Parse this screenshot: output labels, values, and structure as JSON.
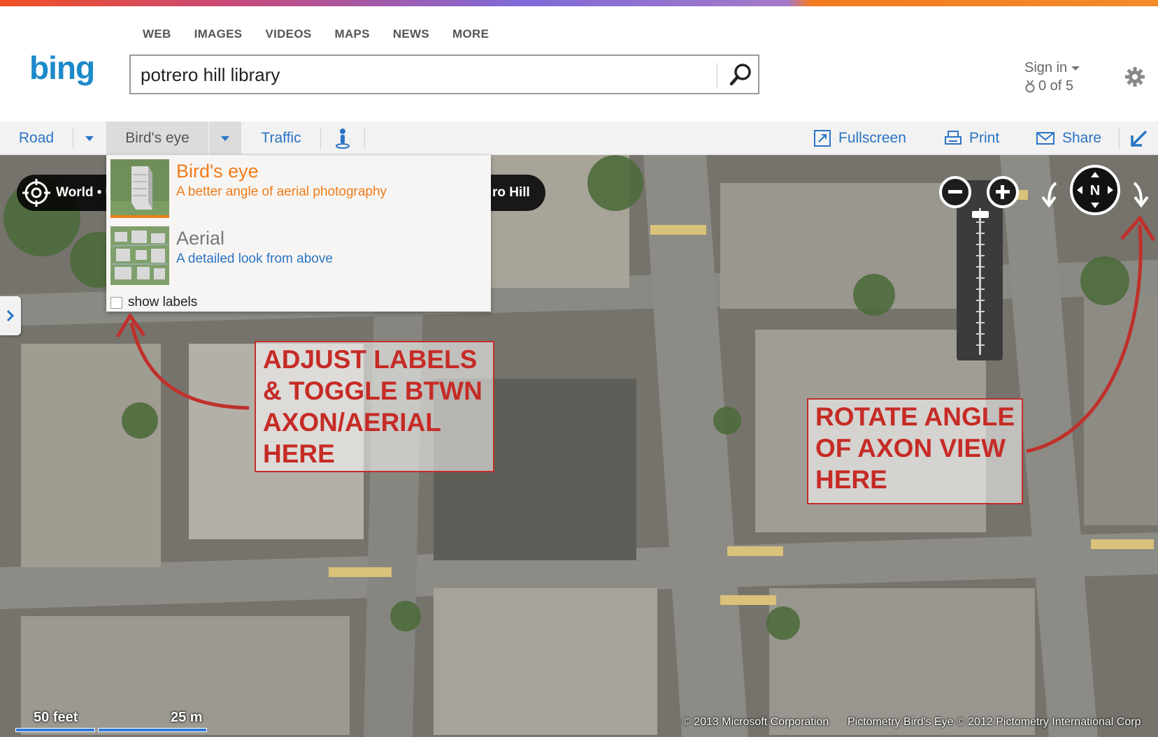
{
  "app": {
    "brand_colors": {
      "top_strip_start": "#f25022",
      "top_strip_end": "#f28c28",
      "bing_blue": "#2a74c4"
    }
  },
  "header": {
    "nav": [
      {
        "label": "WEB"
      },
      {
        "label": "IMAGES"
      },
      {
        "label": "VIDEOS"
      },
      {
        "label": "MAPS"
      },
      {
        "label": "NEWS"
      },
      {
        "label": "MORE"
      }
    ],
    "logo_text": "bing",
    "search_value": "potrero hill library",
    "sign_in": "Sign in",
    "rewards": "0 of 5",
    "settings_icon": "gear-icon"
  },
  "toolbar": {
    "road": "Road",
    "birds_eye": "Bird's eye",
    "traffic": "Traffic",
    "streetside_icon": "person-icon",
    "fullscreen": "Fullscreen",
    "print": "Print",
    "share": "Share",
    "collapse_icon": "arrow-down-left-icon"
  },
  "map": {
    "breadcrumb_start": "World • U",
    "breadcrumb_end": "ro Hill",
    "dropdown": {
      "items": [
        {
          "title": "Bird's eye",
          "subtitle": "A better angle of aerial photography",
          "title_color": "#f07c1a",
          "subtitle_color": "#f07c1a"
        },
        {
          "title": "Aerial",
          "subtitle": "A detailed look from above",
          "title_color": "#777777",
          "subtitle_color": "#2a74c4"
        }
      ],
      "show_labels": "show labels",
      "show_labels_checked": false
    },
    "zoom_out_icon": "minus-icon",
    "zoom_in_icon": "plus-icon",
    "compass_label": "N",
    "scale_feet": "50 feet",
    "scale_meters": "25 m",
    "copyright_ms": "© 2013 Microsoft Corporation",
    "copyright_pictometry": "Pictometry Bird's Eye © 2012 Pictometry International Corp"
  },
  "annotations": {
    "left": "ADJUST LABELS\n& TOGGLE BTWN\nAXON/AERIAL\nHERE",
    "right": "ROTATE ANGLE\nOF AXON VIEW\nHERE",
    "color": "#c62b26"
  }
}
